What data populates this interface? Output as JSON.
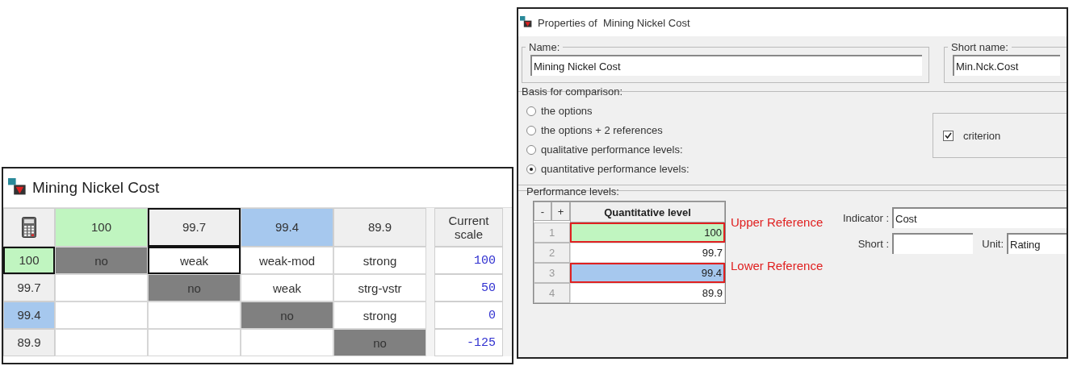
{
  "matrix_window": {
    "title": "Mining Nickel Cost",
    "columns": [
      {
        "label": "100",
        "color": "#c0f5c0",
        "selected": false
      },
      {
        "label": "99.7",
        "selected": true
      },
      {
        "label": "99.4",
        "color": "#a6c8ee",
        "selected": false
      },
      {
        "label": "89.9",
        "selected": false
      }
    ],
    "scale_header": "Current scale",
    "rows": [
      {
        "label": "100",
        "color": "#c0f5c0",
        "selected": true,
        "scale": "100",
        "cells": [
          {
            "kind": "diagonal",
            "text": "no",
            "selected": false
          },
          {
            "kind": "judgment",
            "text": "weak",
            "selected": true
          },
          {
            "kind": "judgment",
            "text": "weak-mod",
            "selected": false
          },
          {
            "kind": "judgment",
            "text": "strong",
            "selected": false
          }
        ]
      },
      {
        "label": "99.7",
        "selected": false,
        "scale": "50",
        "cells": [
          {
            "kind": "empty",
            "selected": false
          },
          {
            "kind": "diagonal",
            "text": "no",
            "selected": false
          },
          {
            "kind": "judgment",
            "text": "weak",
            "selected": false
          },
          {
            "kind": "judgment",
            "text": "strg-vstr",
            "selected": false
          }
        ]
      },
      {
        "label": "99.4",
        "color": "#a6c8ee",
        "selected": false,
        "scale": "0",
        "cells": [
          {
            "kind": "empty",
            "selected": false
          },
          {
            "kind": "empty",
            "selected": false
          },
          {
            "kind": "diagonal",
            "text": "no",
            "selected": false
          },
          {
            "kind": "judgment",
            "text": "strong",
            "selected": false
          }
        ]
      },
      {
        "label": "89.9",
        "selected": false,
        "scale": "-125",
        "cells": [
          {
            "kind": "empty",
            "selected": false
          },
          {
            "kind": "empty",
            "selected": false
          },
          {
            "kind": "empty",
            "selected": false
          },
          {
            "kind": "diagonal",
            "text": "no",
            "selected": false
          }
        ]
      }
    ]
  },
  "properties_window": {
    "title": "Properties of  Mining Nickel Cost",
    "name": {
      "label": "Name:",
      "value": "Mining Nickel Cost"
    },
    "short_name": {
      "label": "Short name:",
      "value": "Min.Nck.Cost"
    },
    "basis": {
      "label": "Basis for comparison:",
      "options": [
        {
          "label": "the options",
          "selected": false
        },
        {
          "label": "the options + 2 references",
          "selected": false
        },
        {
          "label": "qualitative performance levels:",
          "selected": false
        },
        {
          "label": "quantitative performance levels:",
          "selected": true
        }
      ]
    },
    "criterion": {
      "label": "criterion",
      "checked": true
    },
    "performance_levels": {
      "label": "Performance levels:",
      "minus": "-",
      "plus": "+",
      "header": "Quantitative level",
      "rows": [
        {
          "index": "1",
          "value": "100",
          "color": "#c0f5c0",
          "annotation": "Upper Reference"
        },
        {
          "index": "2",
          "value": "99.7"
        },
        {
          "index": "3",
          "value": "99.4",
          "color": "#a6c8ee",
          "annotation": "Lower Reference"
        },
        {
          "index": "4",
          "value": "89.9"
        }
      ],
      "indicator": {
        "label": "Indicator :",
        "value": "Cost"
      },
      "short": {
        "label": "Short :"
      },
      "unit": {
        "label": "Unit:",
        "value": "Rating"
      }
    }
  }
}
